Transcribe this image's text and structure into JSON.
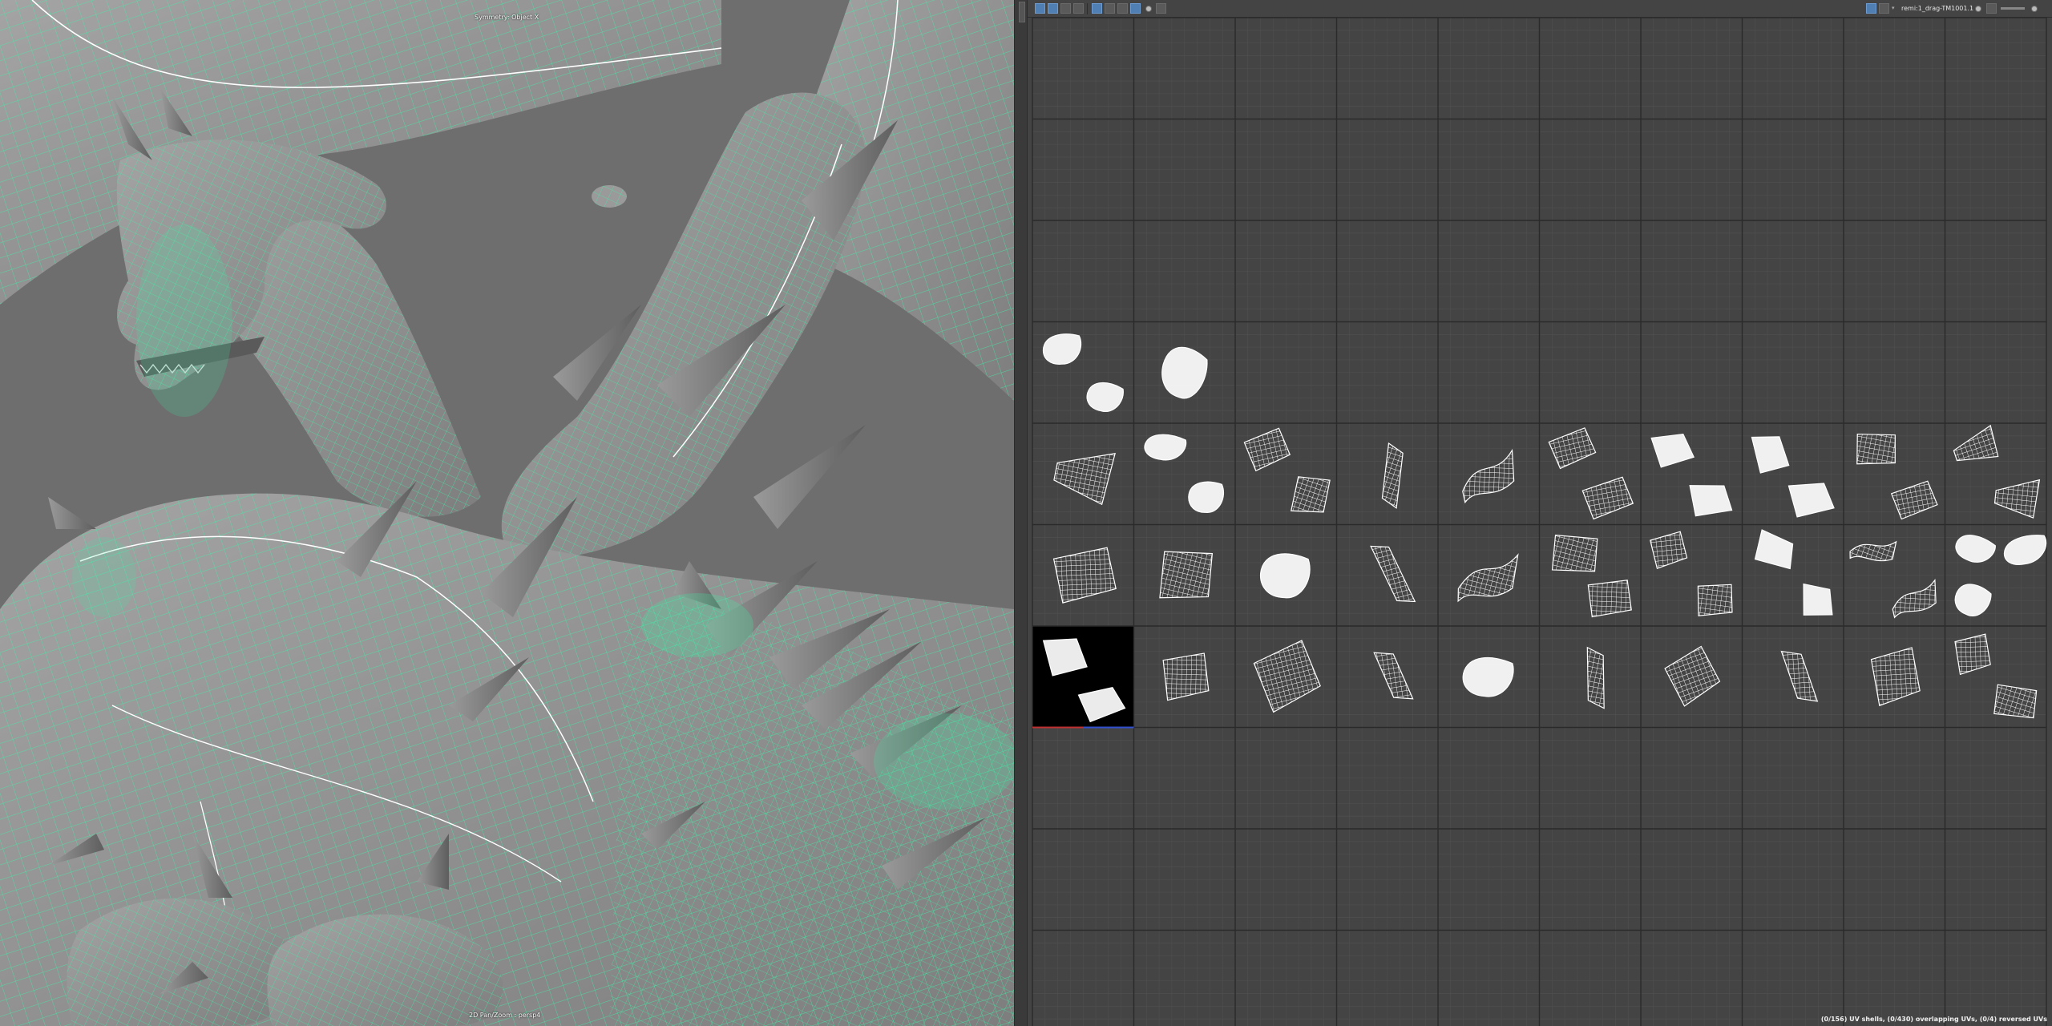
{
  "viewport": {
    "top_label": "Symmetry: Object X",
    "bottom_label": "2D Pan/Zoom : persp4",
    "colors": {
      "background": "#6e6e6e",
      "mesh": "#9c9c9c",
      "wire": "#3ff0a8",
      "seam": "#ffffff",
      "spike": "#8a8a8a"
    }
  },
  "splitter": {
    "grip_icon": "grip-icon"
  },
  "uv_editor": {
    "title": "remi:1_drag-TM1001.1",
    "status": "(0/156) UV shells, (0/430) overlapping UVs, (0/4) reversed UVs",
    "toolbar_left_icons": [
      "texture-icon",
      "checker-icon",
      "filter-icon",
      "image-icon",
      "snapshot-icon",
      "grid-icon",
      "ruler-icon",
      "shaded-icon",
      "dot-icon",
      "camera-icon"
    ],
    "toolbar_right_icons": [
      "display-icon",
      "isolate-icon",
      "dropdown-icon",
      "exposure-icon",
      "gamma-icon",
      "slider-icon",
      "refresh-icon"
    ],
    "colors": {
      "background": "#444444",
      "tile_line": "#2a2a2a",
      "subgrid": "#505050",
      "shell": "#ffffff",
      "selected_tile": "#000000",
      "axis_u": "#c03030",
      "axis_v": "#3050d0"
    },
    "grid": {
      "columns": 10,
      "rows": 10
    },
    "selected_tile": {
      "col": 0,
      "row": 6
    },
    "shells": [
      {
        "col": 0,
        "row": 3,
        "variant": "blob",
        "count": 2
      },
      {
        "col": 1,
        "row": 3,
        "variant": "blob",
        "count": 1
      },
      {
        "col": 0,
        "row": 4,
        "variant": "fan",
        "count": 1
      },
      {
        "col": 1,
        "row": 4,
        "variant": "blob",
        "count": 2
      },
      {
        "col": 2,
        "row": 4,
        "variant": "quad",
        "count": 2
      },
      {
        "col": 3,
        "row": 4,
        "variant": "strip",
        "count": 1
      },
      {
        "col": 4,
        "row": 4,
        "variant": "curve",
        "count": 1
      },
      {
        "col": 5,
        "row": 4,
        "variant": "quad",
        "count": 2
      },
      {
        "col": 6,
        "row": 4,
        "variant": "solid",
        "count": 2
      },
      {
        "col": 7,
        "row": 4,
        "variant": "solid",
        "count": 2
      },
      {
        "col": 8,
        "row": 4,
        "variant": "quad",
        "count": 2
      },
      {
        "col": 9,
        "row": 4,
        "variant": "fan",
        "count": 2
      },
      {
        "col": 0,
        "row": 5,
        "variant": "quad",
        "count": 1
      },
      {
        "col": 1,
        "row": 5,
        "variant": "quad",
        "count": 1
      },
      {
        "col": 2,
        "row": 5,
        "variant": "blob",
        "count": 1
      },
      {
        "col": 3,
        "row": 5,
        "variant": "strip",
        "count": 1
      },
      {
        "col": 4,
        "row": 5,
        "variant": "curve",
        "count": 1
      },
      {
        "col": 5,
        "row": 5,
        "variant": "quad",
        "count": 2
      },
      {
        "col": 6,
        "row": 5,
        "variant": "quad",
        "count": 2
      },
      {
        "col": 7,
        "row": 5,
        "variant": "solid",
        "count": 2
      },
      {
        "col": 8,
        "row": 5,
        "variant": "curve",
        "count": 2
      },
      {
        "col": 9,
        "row": 5,
        "variant": "blob",
        "count": 3
      },
      {
        "col": 0,
        "row": 6,
        "variant": "solid",
        "count": 2
      },
      {
        "col": 1,
        "row": 6,
        "variant": "quad",
        "count": 1
      },
      {
        "col": 2,
        "row": 6,
        "variant": "quad",
        "count": 1
      },
      {
        "col": 3,
        "row": 6,
        "variant": "strip",
        "count": 1
      },
      {
        "col": 4,
        "row": 6,
        "variant": "blob",
        "count": 1
      },
      {
        "col": 5,
        "row": 6,
        "variant": "strip",
        "count": 1
      },
      {
        "col": 6,
        "row": 6,
        "variant": "quad",
        "count": 1
      },
      {
        "col": 7,
        "row": 6,
        "variant": "strip",
        "count": 1
      },
      {
        "col": 8,
        "row": 6,
        "variant": "quad",
        "count": 1
      },
      {
        "col": 9,
        "row": 6,
        "variant": "quad",
        "count": 2
      }
    ]
  }
}
